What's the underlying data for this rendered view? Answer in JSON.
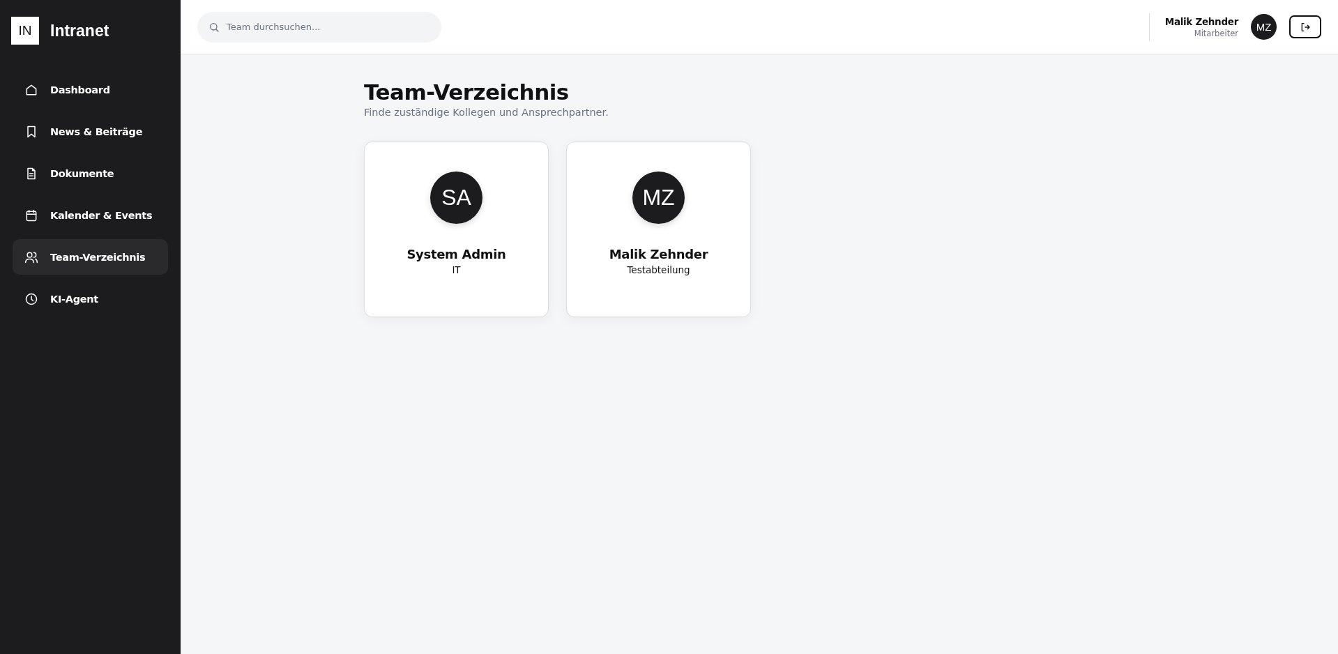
{
  "sidebar": {
    "logo": {
      "badge": "IN",
      "title": "Intranet"
    },
    "items": [
      {
        "label": "Dashboard",
        "selected": false
      },
      {
        "label": "News & Beiträge",
        "selected": false
      },
      {
        "label": "Dokumente",
        "selected": false
      },
      {
        "label": "Kalender & Events",
        "selected": false
      },
      {
        "label": "Team-Verzeichnis",
        "selected": true
      },
      {
        "label": "KI-Agent",
        "selected": false
      }
    ]
  },
  "header": {
    "search": {
      "placeholder": "Team durchsuchen..."
    },
    "user": {
      "name": "Malik Zehnder",
      "role": "Mitarbeiter",
      "initials": "MZ"
    }
  },
  "page": {
    "title": "Team-Verzeichnis",
    "subtitle": "Finde zuständige Kollegen und Ansprechpartner.",
    "members": [
      {
        "initials": "SA",
        "name": "System Admin",
        "department": "IT"
      },
      {
        "initials": "MZ",
        "name": "Malik Zehnder",
        "department": "Testabteilung"
      }
    ]
  }
}
